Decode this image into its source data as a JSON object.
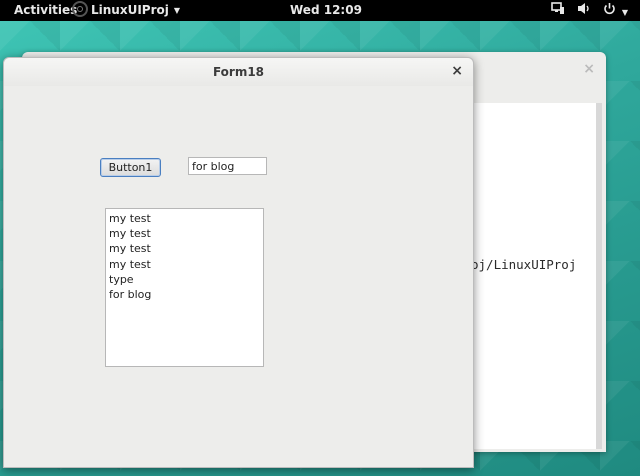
{
  "topbar": {
    "activities": "Activities",
    "app_name": "LinuxUIProj",
    "clock": "Wed 12:09",
    "tray_icons": [
      "display-icon",
      "volume-icon",
      "power-icon"
    ]
  },
  "background_window": {
    "visible_text": "oj/LinuxUIProj",
    "close_glyph": "×"
  },
  "form": {
    "title": "Form18",
    "close_glyph": "×",
    "button1_label": "Button1",
    "textbox_value": "for blog",
    "list_items": [
      "my test",
      "my test",
      "my test",
      "my test",
      "type",
      "for blog"
    ]
  },
  "colors": {
    "topbar": "#000000",
    "desktop": "#2fa89c",
    "window_bg": "#ededeb",
    "button_focus_border": "#4a7fc1"
  }
}
